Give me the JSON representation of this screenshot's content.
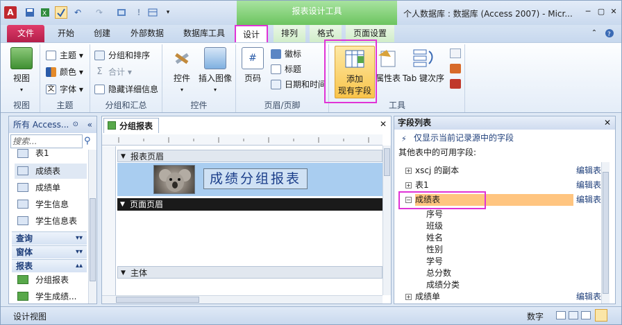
{
  "window": {
    "title": "个人数据库 : 数据库 (Access 2007) - Micr...",
    "context_band": "报表设计工具",
    "quick_access_icons": [
      "app-access-icon",
      "save-icon",
      "excel-icon",
      "checkbox-icon",
      "undo-icon",
      "redo-icon",
      "picture-icon",
      "exclaim-icon",
      "form-icon",
      "dropdown-icon"
    ],
    "app_icon_letter": "A"
  },
  "tabs": [
    {
      "label": "文件"
    },
    {
      "label": "开始"
    },
    {
      "label": "创建"
    },
    {
      "label": "外部数据"
    },
    {
      "label": "数据库工具"
    },
    {
      "label": "设计"
    },
    {
      "label": "排列"
    },
    {
      "label": "格式"
    },
    {
      "label": "页面设置"
    }
  ],
  "ribbon": {
    "groups": {
      "view": "视图",
      "theme": "主题",
      "grouping": "分组和汇总",
      "controls": "控件",
      "header_footer": "页眉/页脚",
      "tools": "工具"
    },
    "view_btn": "视图",
    "theme_btns": [
      "主题",
      "颜色",
      "字体"
    ],
    "grouping_btns": [
      "分组和排序",
      "合计",
      "隐藏详细信息"
    ],
    "controls_btns": [
      "控件",
      "插入图像"
    ],
    "page_number": "页码",
    "hf_btns": [
      "徽标",
      "标题",
      "日期和时间"
    ],
    "add_fields_line1": "添加",
    "add_fields_line2": "现有字段",
    "property_sheet": "属性表",
    "tab_order": "Tab 键次序"
  },
  "nav": {
    "header": "所有 Access...",
    "search_placeholder": "搜索...",
    "items_top": [
      "表1",
      "成绩表",
      "成绩单",
      "学生信息",
      "学生信息表"
    ],
    "sections": [
      "查询",
      "窗体",
      "报表"
    ],
    "report_items": [
      "分组报表",
      "学生成绩..."
    ]
  },
  "doc": {
    "tab": "分组报表",
    "sections": [
      "报表页眉",
      "页面页眉",
      "主体"
    ],
    "report_title": "成绩分组报表"
  },
  "field_list": {
    "header": "字段列表",
    "show_only_current": "仅显示当前记录源中的字段",
    "other_tables_label": "其他表中的可用字段:",
    "tables": [
      {
        "name": "xscj 的副本",
        "expanded": false
      },
      {
        "name": "表1",
        "expanded": false
      },
      {
        "name": "成绩表",
        "expanded": true
      },
      {
        "name": "成绩单",
        "expanded": false
      }
    ],
    "edit_label": "编辑表",
    "fields": [
      "序号",
      "班级",
      "姓名",
      "性别",
      "学号",
      "总分数",
      "成绩分类"
    ]
  },
  "status": {
    "left": "设计视图",
    "right": "数字"
  },
  "colors": {
    "accent": "#e033d6",
    "file_tab": "#c7285a",
    "context_green": "#6cc45f",
    "highlight_row": "#ffc580"
  }
}
